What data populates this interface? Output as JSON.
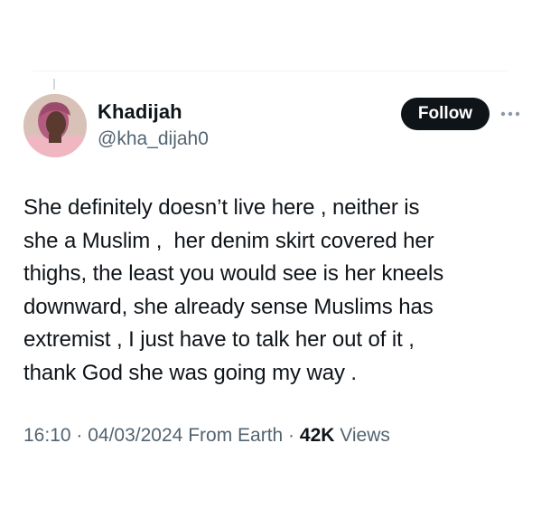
{
  "tweet": {
    "author": {
      "display_name": "Khadijah",
      "handle": "@kha_dijah0"
    },
    "follow_label": "Follow",
    "more_icon": "more-horizontal-icon",
    "text_lines": [
      "She definitely doesn’t live here , neither is",
      "she a Muslim ,  her denim skirt covered her",
      "thighs, the least you would see is her kneels",
      "downward, she already sense Muslims has",
      "extremist , I just have to talk her out of it ,",
      "thank God she was going my way ."
    ],
    "meta": {
      "time": "16:10",
      "separator": " · ",
      "date": "04/03/2024",
      "source": "From Earth",
      "views_count": "42K",
      "views_label": "Views"
    }
  },
  "colors": {
    "text_primary": "#0f1419",
    "text_secondary": "#536471",
    "follow_bg": "#0f1419",
    "follow_text": "#ffffff"
  }
}
